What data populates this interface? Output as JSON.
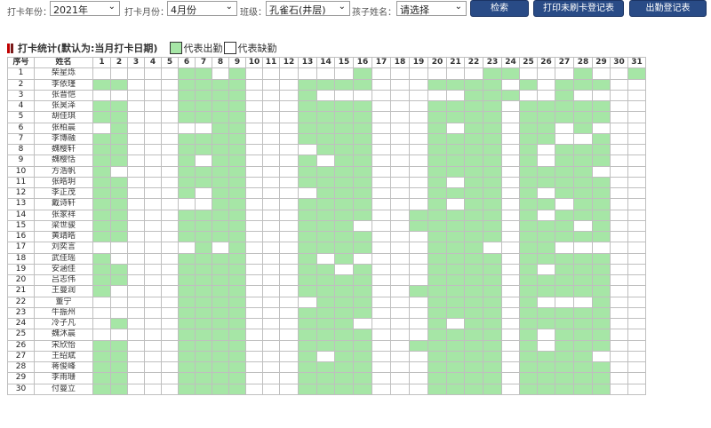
{
  "toolbar": {
    "year_label": "打卡年份：",
    "year_value": "2021年",
    "month_label": "打卡月份：",
    "month_value": "4月份",
    "class_label": "班级：",
    "class_value": "孔雀石(井层)",
    "child_label": "孩子姓名：",
    "child_value": "请选择",
    "search_label": "检索",
    "print_label": "打印未刷卡登记表",
    "attendance_label": "出勤登记表"
  },
  "section": {
    "title": "打卡统计(默认为:当月打卡日期)",
    "legend_attend": "代表出勤",
    "legend_absent": "代表缺勤"
  },
  "colors": {
    "attend": "#a6e6a6",
    "absent": "#ffffff",
    "button": "#294b86"
  },
  "table": {
    "col_index": "序号",
    "col_name": "姓名",
    "days": [
      "1",
      "2",
      "3",
      "4",
      "5",
      "6",
      "7",
      "8",
      "9",
      "10",
      "11",
      "12",
      "13",
      "14",
      "15",
      "16",
      "17",
      "18",
      "19",
      "20",
      "21",
      "22",
      "23",
      "24",
      "25",
      "26",
      "27",
      "28",
      "29",
      "30",
      "31"
    ],
    "rows": [
      {
        "no": "1",
        "name": "柴星烁",
        "cells": "0000011010000001000000110001001"
      },
      {
        "no": "2",
        "name": "李依瑾",
        "cells": "1100011110001111000111101011100"
      },
      {
        "no": "3",
        "name": "张晋恺",
        "cells": "0000011110001000000001110010000"
      },
      {
        "no": "4",
        "name": "张昊泽",
        "cells": "1100011110001111000111101111100"
      },
      {
        "no": "5",
        "name": "胡佳琪",
        "cells": "1100011110001111000111101111100"
      },
      {
        "no": "6",
        "name": "张柏晨",
        "cells": "0100000110001111000101101101000"
      },
      {
        "no": "7",
        "name": "李博融",
        "cells": "1100011110001111000111101100100"
      },
      {
        "no": "8",
        "name": "魏樱轩",
        "cells": "1100011110000111000111101011100"
      },
      {
        "no": "9",
        "name": "魏樱恬",
        "cells": "1100010110001011000111101011100"
      },
      {
        "no": "10",
        "name": "方浩帆",
        "cells": "1000011110001111000111101111000"
      },
      {
        "no": "11",
        "name": "张皓玥",
        "cells": "1100011110001111000101101111100"
      },
      {
        "no": "12",
        "name": "李正茂",
        "cells": "1100010110000111000111101011100"
      },
      {
        "no": "13",
        "name": "戴诗轩",
        "cells": "1100000110001111000101101101100"
      },
      {
        "no": "14",
        "name": "张家祥",
        "cells": "1100011110001111001111101011100"
      },
      {
        "no": "15",
        "name": "梁世骏",
        "cells": "1100011110001110001111101110100"
      },
      {
        "no": "16",
        "name": "黄靖皓",
        "cells": "1100011110001111000111101111100"
      },
      {
        "no": "17",
        "name": "刘奕言",
        "cells": "0000001010001111000111001100000"
      },
      {
        "no": "18",
        "name": "武佳瑶",
        "cells": "1000011110001010000111101111100"
      },
      {
        "no": "19",
        "name": "安涵佳",
        "cells": "1100011110001101000111101011100"
      },
      {
        "no": "20",
        "name": "吕志伟",
        "cells": "1100011110001111000111101111100"
      },
      {
        "no": "21",
        "name": "王曼润",
        "cells": "1000011110001111001111101111100"
      },
      {
        "no": "22",
        "name": "董宁",
        "cells": "0000011110000111000111101000100"
      },
      {
        "no": "23",
        "name": "牛振州",
        "cells": "0000011110001111000111101111100"
      },
      {
        "no": "24",
        "name": "冷子凡",
        "cells": "0100011110001110000101101111100"
      },
      {
        "no": "25",
        "name": "魏沐晨",
        "cells": "0000011110001111000111101011100"
      },
      {
        "no": "26",
        "name": "宋欣怡",
        "cells": "1100011110001111001111101011100"
      },
      {
        "no": "27",
        "name": "王绍斌",
        "cells": "1100011110001011000111101111000"
      },
      {
        "no": "28",
        "name": "蒋俊峰",
        "cells": "1100011110001111000111101111100"
      },
      {
        "no": "29",
        "name": "李雨珊",
        "cells": "1100011110001111000111101111100"
      },
      {
        "no": "30",
        "name": "付曼立",
        "cells": "1100011110001111000111101111100"
      }
    ]
  }
}
